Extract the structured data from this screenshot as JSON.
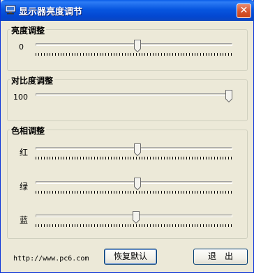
{
  "window": {
    "title": "显示器亮度调节",
    "close_glyph": "✕"
  },
  "brightness": {
    "group_title": "亮度调整",
    "value_label": "0",
    "level_percent": 52
  },
  "contrast": {
    "group_title": "对比度调整",
    "value_label": "100",
    "level_percent": 100
  },
  "hue": {
    "group_title": "色相调整",
    "sliders": [
      {
        "label": "红",
        "level_percent": 52
      },
      {
        "label": "绿",
        "level_percent": 52
      },
      {
        "label": "蓝",
        "level_percent": 51
      }
    ]
  },
  "footer": {
    "url": "http://www.pc6.com",
    "restore_default_label": "恢复默认",
    "exit_label": "退　出"
  },
  "colors": {
    "titlebar": "#0756e0",
    "face": "#ece9d8"
  }
}
